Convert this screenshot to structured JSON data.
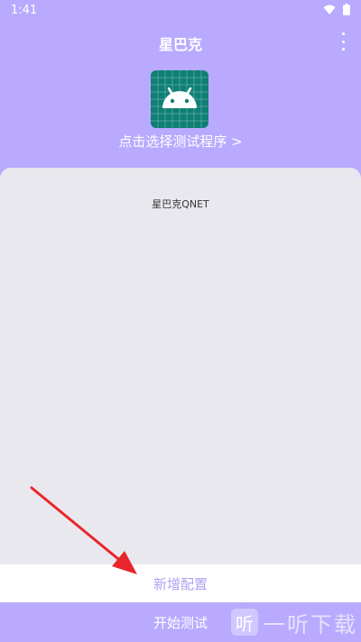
{
  "status_bar": {
    "time": "1:41"
  },
  "app_bar": {
    "title": "星巴克"
  },
  "header": {
    "select_program": "点击选择测试程序 >"
  },
  "config_list": {
    "items": [
      {
        "label": "星巴克QNET"
      }
    ]
  },
  "buttons": {
    "add_config": "新增配置",
    "start_test": "开始测试"
  },
  "watermark": {
    "badge": "听",
    "text": "一听下载"
  },
  "colors": {
    "accent": "#b9aaff",
    "panel": "#e9e8ee",
    "icon_bg": "#0f7f74",
    "arrow": "#e8262b"
  },
  "icons": [
    "wifi-icon",
    "battery-icon",
    "more-vert-icon",
    "android-icon",
    "arrow-annotation"
  ]
}
